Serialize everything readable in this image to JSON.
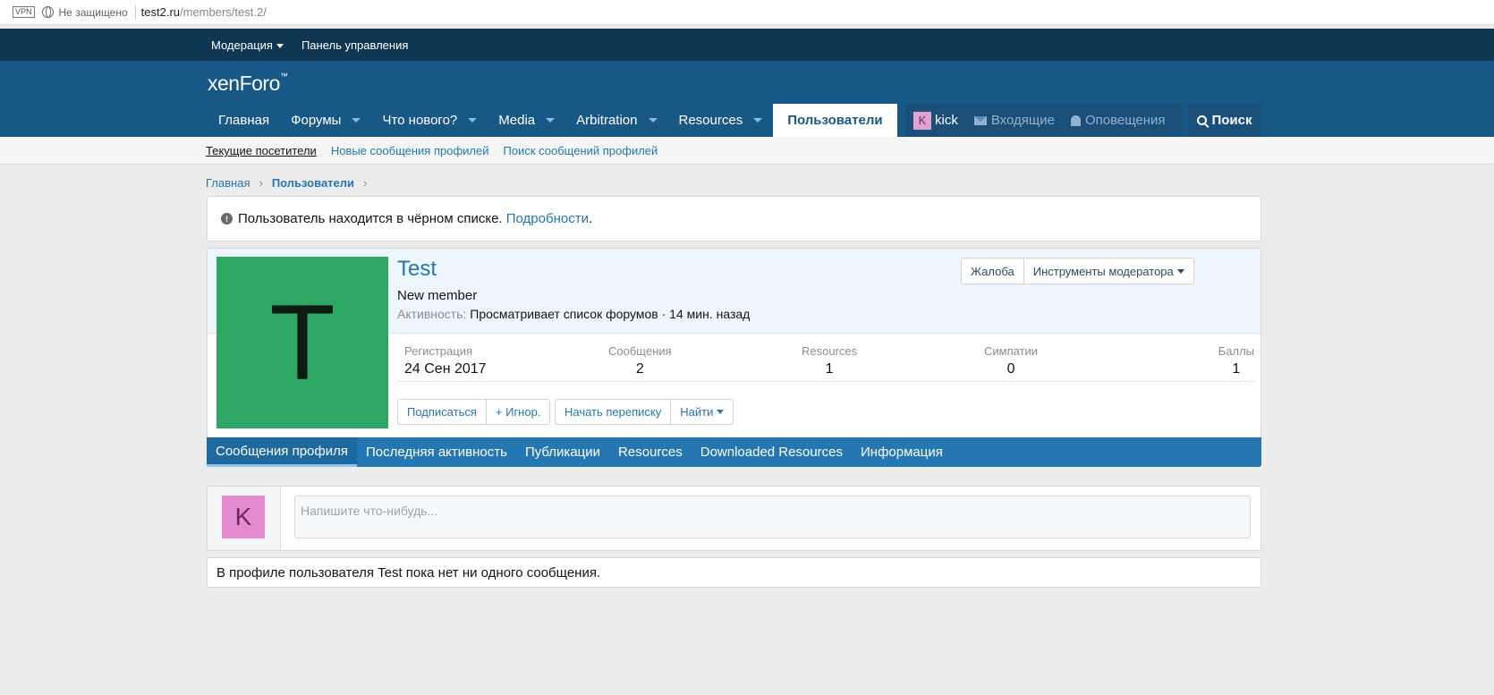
{
  "browser": {
    "vpn": "VPN",
    "security_text": "Не защищено",
    "url_host": "test2.ru",
    "url_path": "/members/test.2/"
  },
  "staff": {
    "moderation": "Модерация",
    "admin_panel": "Панель управления"
  },
  "header": {
    "logo_main": "xenForo",
    "logo_tm": "™"
  },
  "nav": {
    "home": "Главная",
    "forums": "Форумы",
    "whats_new": "Что нового?",
    "media": "Media",
    "arbitration": "Arbitration",
    "resources": "Resources",
    "members": "Пользователи"
  },
  "user": {
    "avatar_letter": "K",
    "name": "kick",
    "inbox": "Входящие",
    "alerts": "Оповещения",
    "search": "Поиск"
  },
  "subnav": {
    "current_visitors": "Текущие посетители",
    "new_profile_posts": "Новые сообщения профилей",
    "search_profile_posts": "Поиск сообщений профилей"
  },
  "breadcrumb": {
    "home": "Главная",
    "members": "Пользователи",
    "sep": "›"
  },
  "notice": {
    "icon": "!",
    "text": "Пользователь находится в чёрном списке. ",
    "link": "Подробности",
    "end": "."
  },
  "profile": {
    "avatar_letter": "T",
    "username": "Test",
    "user_title": "New member",
    "activity_label": "Активность:",
    "activity_value": "Просматривает список форумов · 14 мин. назад",
    "report": "Жалоба",
    "mod_tools": "Инструменты модератора",
    "stats": [
      {
        "label": "Регистрация",
        "value": "24 Сен 2017"
      },
      {
        "label": "Сообщения",
        "value": "2"
      },
      {
        "label": "Resources",
        "value": "1"
      },
      {
        "label": "Симпатии",
        "value": "0"
      },
      {
        "label": "Баллы",
        "value": "1"
      }
    ],
    "follow": "Подписаться",
    "ignore": "+ Игнор.",
    "start_convo": "Начать переписку",
    "find": "Найти"
  },
  "tabs": [
    "Сообщения профиля",
    "Последняя активность",
    "Публикации",
    "Resources",
    "Downloaded Resources",
    "Информация"
  ],
  "status": {
    "avatar_letter": "K",
    "placeholder": "Напишите что-нибудь..."
  },
  "empty_message": "В профиле пользователя Test пока нет ни одного сообщения.",
  "colors": {
    "header_bg": "#185886",
    "staff_bg": "#0f3652",
    "link": "#2577b1",
    "avatar_green": "#2ea765",
    "avatar_pink": "#e28bd1"
  }
}
